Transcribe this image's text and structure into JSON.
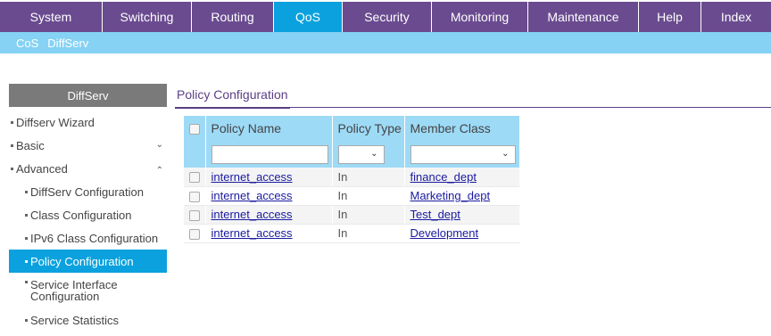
{
  "topnav": {
    "tabs": [
      {
        "label": "System",
        "width": 115
      },
      {
        "label": "Switching",
        "width": 100
      },
      {
        "label": "Routing",
        "width": 92
      },
      {
        "label": "QoS",
        "width": 77,
        "active": true
      },
      {
        "label": "Security",
        "width": 100
      },
      {
        "label": "Monitoring",
        "width": 108
      },
      {
        "label": "Maintenance",
        "width": 124
      },
      {
        "label": "Help",
        "width": 70
      },
      {
        "label": "Index",
        "width": 78
      }
    ]
  },
  "subnav": {
    "items": [
      {
        "label": "CoS"
      },
      {
        "label": "DiffServ",
        "active": true
      }
    ]
  },
  "sidebar": {
    "header": "DiffServ",
    "items": [
      {
        "label": "Diffserv Wizard"
      },
      {
        "label": "Basic"
      },
      {
        "label": "Advanced"
      },
      {
        "label": "DiffServ Configuration"
      },
      {
        "label": "Class Configuration"
      },
      {
        "label": "IPv6 Class Configuration"
      },
      {
        "label": "Policy Configuration"
      },
      {
        "label": "Service Interface Configuration"
      },
      {
        "label": "Service Statistics"
      }
    ]
  },
  "main": {
    "tab": "Policy Configuration",
    "table": {
      "headers": [
        "Policy Name",
        "Policy Type",
        "Member Class"
      ],
      "rows": [
        {
          "policy_name": "internet_access",
          "policy_type": "In",
          "member_class": "finance_dept"
        },
        {
          "policy_name": "internet_access",
          "policy_type": "In",
          "member_class": "Marketing_dept"
        },
        {
          "policy_name": "internet_access",
          "policy_type": "In",
          "member_class": "Test_dept"
        },
        {
          "policy_name": "internet_access",
          "policy_type": "In",
          "member_class": "Development"
        }
      ]
    }
  },
  "colors": {
    "topnav_bg": "#6a4b8f",
    "active_tab": "#0aa1de",
    "subnav_bg": "#85d2f4",
    "table_header": "#9ddaf6",
    "link": "#1a1aa0"
  },
  "icons": {
    "chevron_down": "chevron-down-icon",
    "chevron_up": "chevron-up-icon",
    "checkbox": "checkbox-icon"
  }
}
